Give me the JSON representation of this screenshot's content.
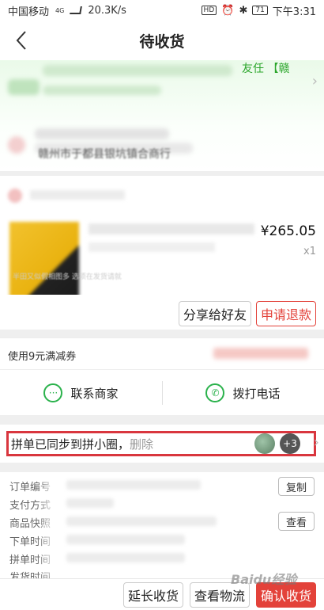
{
  "statusbar": {
    "carrier": "中国移动",
    "net_badge": "4G",
    "speed": "20.3K/s",
    "icons": [
      "hd-icon",
      "alarm-icon",
      "bluetooth-icon"
    ],
    "battery": "71",
    "time": "下午3:31"
  },
  "header": {
    "title": "待收货"
  },
  "banner": {
    "visible_text": "友任 【赣",
    "address_fragment": "赣州市于都县银坑镇合商行"
  },
  "product": {
    "price": "¥265.05",
    "quantity": "x1",
    "image_caption": "半田又似假相图多 选项在发货请就"
  },
  "actions": {
    "share_label": "分享给好友",
    "refund_label": "申请退款"
  },
  "coupon": {
    "label": "使用9元满减券"
  },
  "contact": {
    "merchant_label": "联系商家",
    "call_label": "拨打电话"
  },
  "group": {
    "text": "拼单已同步到拼小圈，",
    "delete_label": "删除",
    "extra_count": "+3"
  },
  "order": {
    "rows": [
      "订单编号",
      "支付方式",
      "商品快照",
      "下单时间",
      "拼单时间",
      "发货时间"
    ],
    "copy_label": "复制",
    "view_label": "查看"
  },
  "bottom": {
    "extend_label": "延长收货",
    "logistics_label": "查看物流",
    "confirm_label": "确认收货"
  },
  "watermark": "Baidu经验",
  "colors": {
    "accent_red": "#e3423a",
    "green": "#2bb24c",
    "highlight_border": "#d9363e"
  }
}
